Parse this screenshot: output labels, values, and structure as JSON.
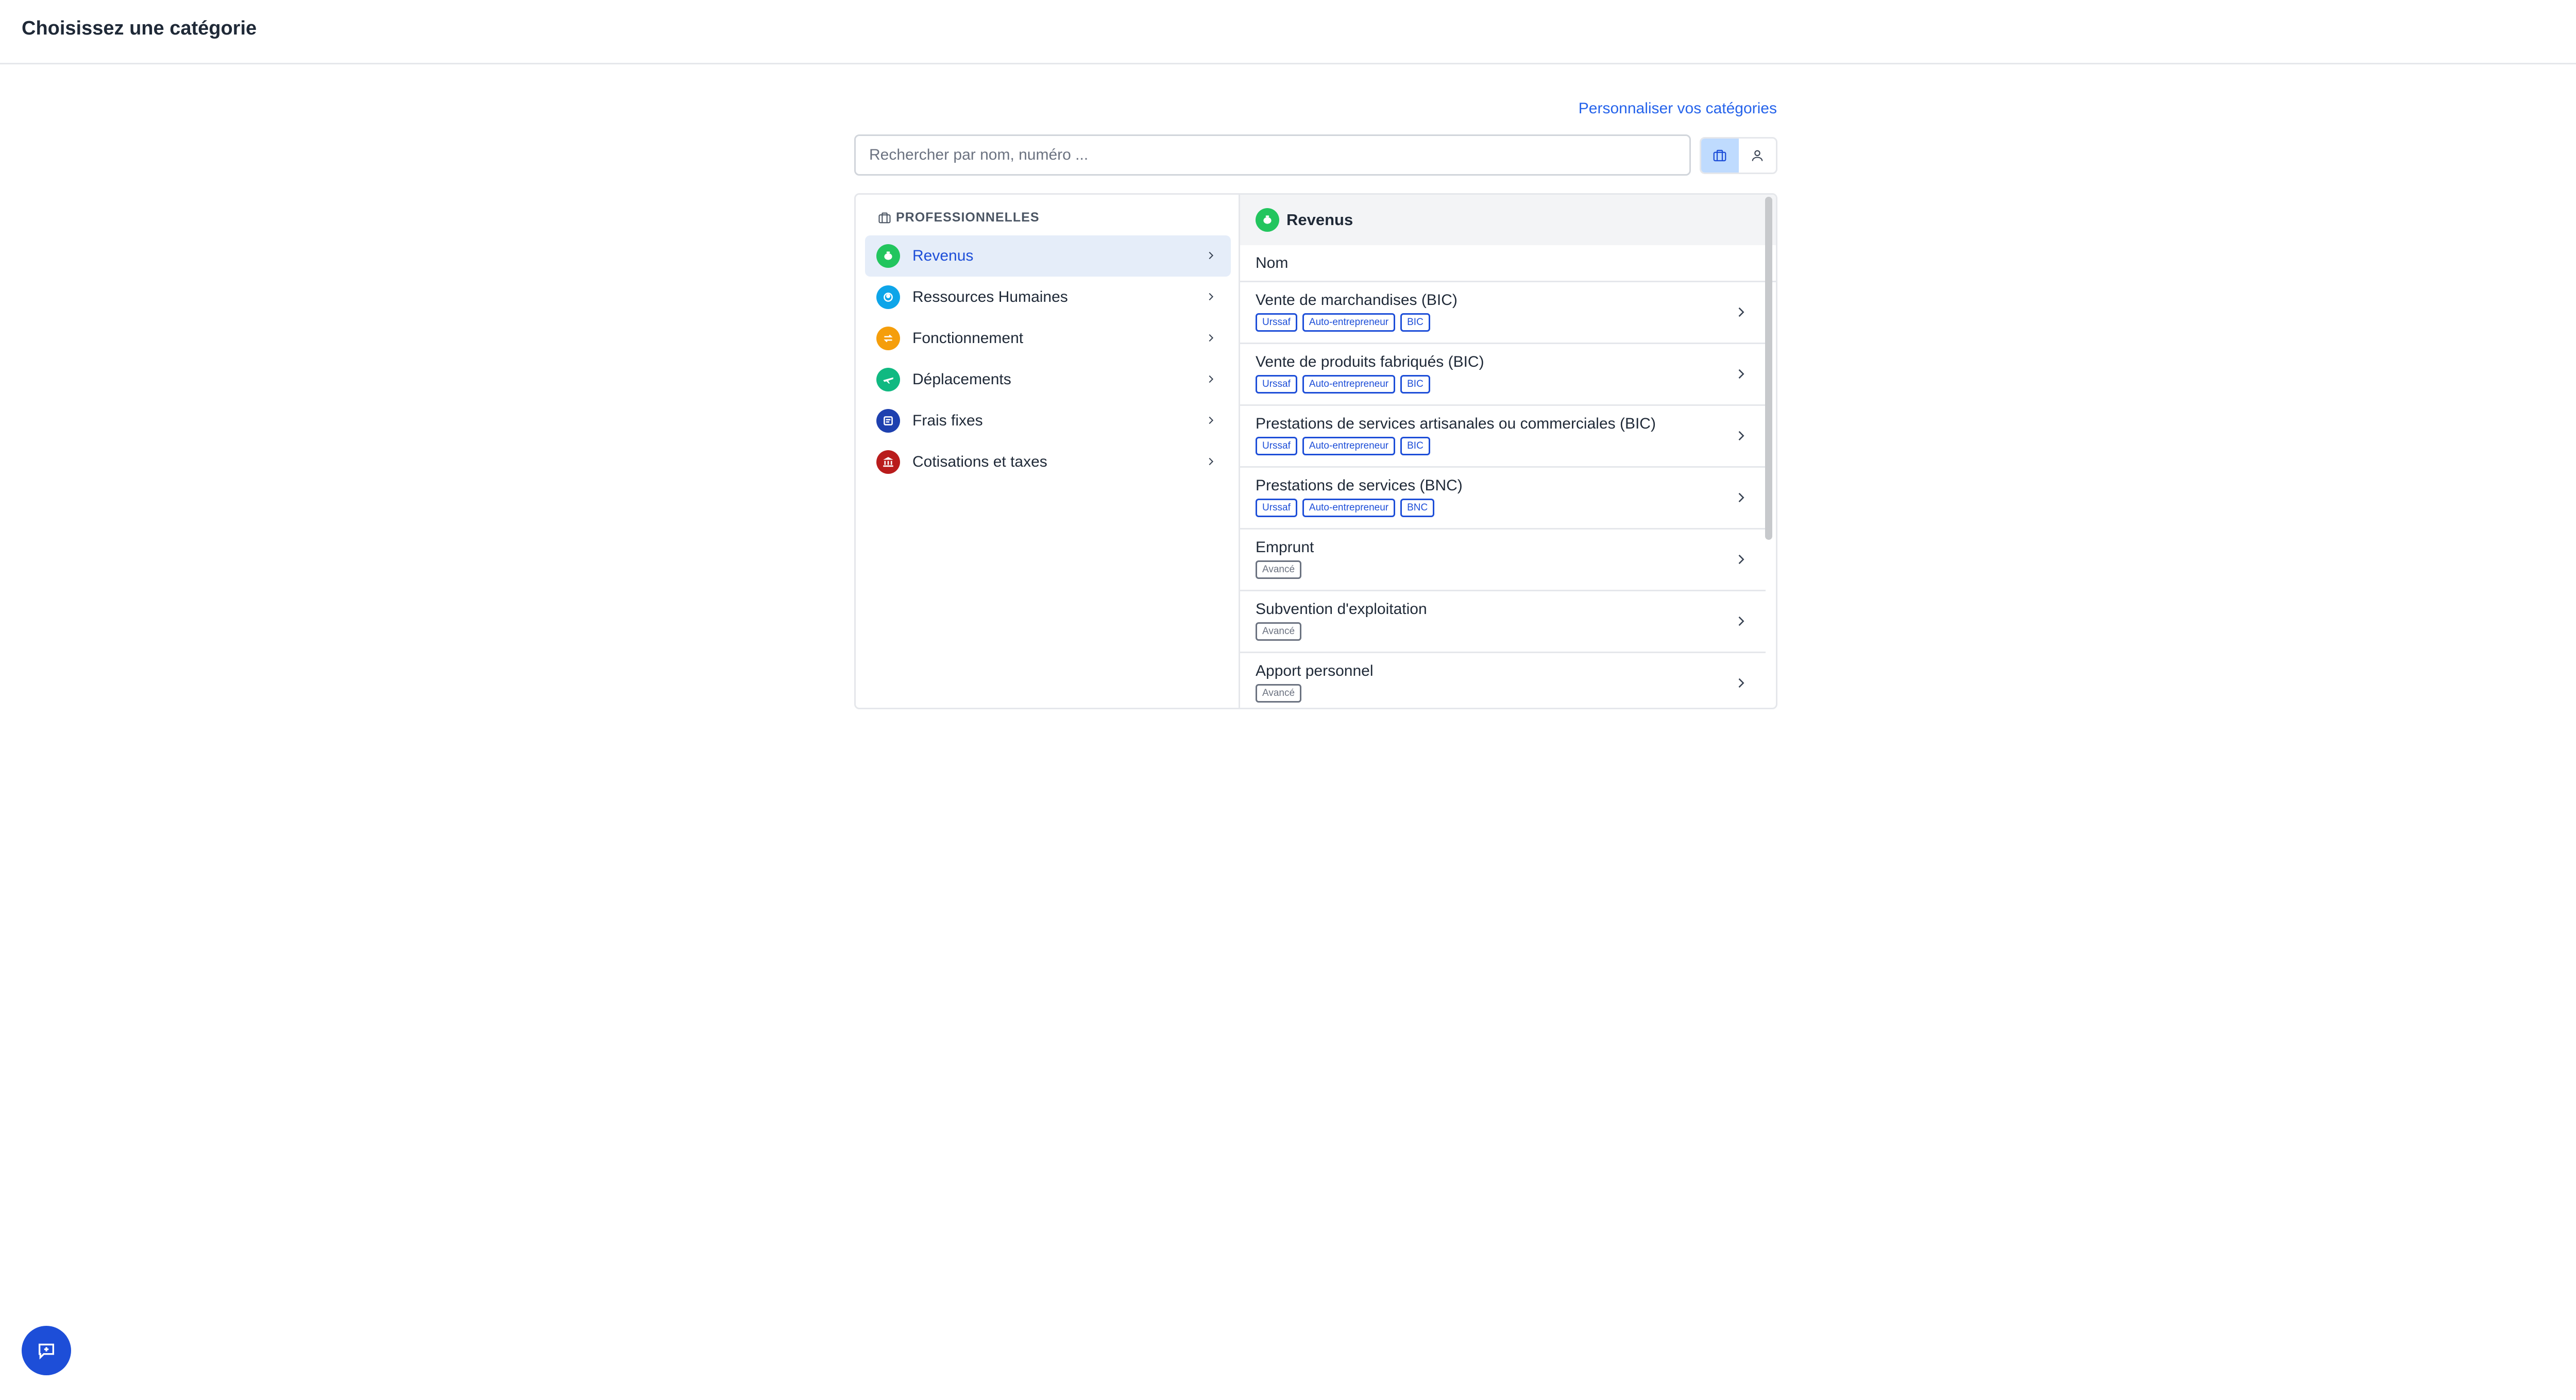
{
  "header": {
    "title": "Choisissez une catégorie"
  },
  "customize_link": "Personnaliser vos catégories",
  "search": {
    "placeholder": "Rechercher par nom, numéro ...",
    "value": ""
  },
  "view_toggle": {
    "options": [
      "professional",
      "personal"
    ],
    "active": "professional"
  },
  "sidebar": {
    "section_label": "PROFESSIONNELLES",
    "items": [
      {
        "label": "Revenus",
        "color": "#22c55e",
        "icon": "piggy-bank-icon",
        "active": true
      },
      {
        "label": "Ressources Humaines",
        "color": "#0ea5e9",
        "icon": "user-circle-icon",
        "active": false
      },
      {
        "label": "Fonctionnement",
        "color": "#f59e0b",
        "icon": "transfer-icon",
        "active": false
      },
      {
        "label": "Déplacements",
        "color": "#10b981",
        "icon": "plane-icon",
        "active": false
      },
      {
        "label": "Frais fixes",
        "color": "#1e40af",
        "icon": "invoice-icon",
        "active": false
      },
      {
        "label": "Cotisations et taxes",
        "color": "#b91c1c",
        "icon": "bank-icon",
        "active": false
      }
    ]
  },
  "detail": {
    "title": "Revenus",
    "column_header": "Nom",
    "rows": [
      {
        "name": "Vente de marchandises (BIC)",
        "tags": [
          "Urssaf",
          "Auto-entrepreneur",
          "BIC"
        ]
      },
      {
        "name": "Vente de produits fabriqués (BIC)",
        "tags": [
          "Urssaf",
          "Auto-entrepreneur",
          "BIC"
        ]
      },
      {
        "name": "Prestations de services artisanales ou commerciales (BIC)",
        "tags": [
          "Urssaf",
          "Auto-entrepreneur",
          "BIC"
        ]
      },
      {
        "name": "Prestations de services (BNC)",
        "tags": [
          "Urssaf",
          "Auto-entrepreneur",
          "BNC"
        ]
      },
      {
        "name": "Emprunt",
        "tags": [
          "Avancé"
        ]
      },
      {
        "name": "Subvention d'exploitation",
        "tags": [
          "Avancé"
        ]
      },
      {
        "name": "Apport personnel",
        "tags": [
          "Avancé"
        ]
      }
    ]
  },
  "colors": {
    "accent": "#2563eb",
    "active_bg": "#e5edf9",
    "chat_button": "#1d4ed8"
  }
}
